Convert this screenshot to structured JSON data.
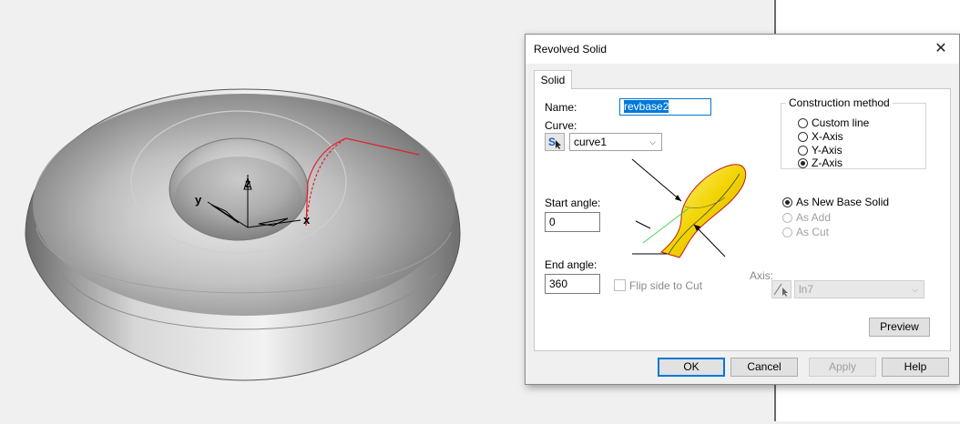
{
  "dialog": {
    "title": "Revolved Solid",
    "close_glyph": "✕",
    "tab_label": "Solid",
    "name_label": "Name:",
    "name_value": "revbase2",
    "curve_label": "Curve:",
    "curve_value": "curve1",
    "start_angle_label": "Start angle:",
    "start_angle_value": "0",
    "end_angle_label": "End angle:",
    "end_angle_value": "360",
    "flip_label": "Flip side to Cut",
    "flip_checked": false,
    "axis_label": "Axis:",
    "axis_value": "ln7",
    "construction": {
      "legend": "Construction method",
      "options": [
        "Custom line",
        "X-Axis",
        "Y-Axis",
        "Z-Axis"
      ],
      "selected": "Z-Axis"
    },
    "mode": {
      "options": [
        "As New Base Solid",
        "As Add",
        "As Cut"
      ],
      "selected": "As New Base Solid",
      "disabled": [
        "As Add",
        "As Cut"
      ]
    },
    "buttons": {
      "preview": "Preview",
      "ok": "OK",
      "cancel": "Cancel",
      "apply": "Apply",
      "help": "Help"
    }
  },
  "viewport": {
    "axis_labels": {
      "x": "x",
      "y": "y",
      "z": "z"
    },
    "profile_curve_color": "#e0202a",
    "solid_color": "#9a9a9a"
  },
  "colors": {
    "accent": "#0078d7",
    "illustration_fill": "#f2d400"
  },
  "icons": [
    "close-icon",
    "pick-curve-icon",
    "pick-axis-icon",
    "dropdown-arrow-icon"
  ]
}
